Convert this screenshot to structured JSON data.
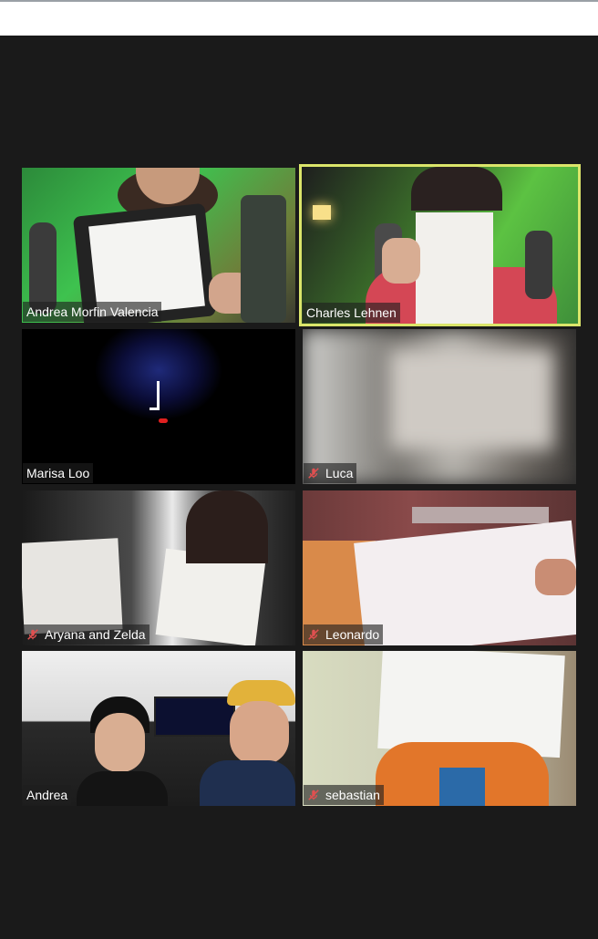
{
  "participants": [
    {
      "name": "Andrea Morfin Valencia",
      "muted": false,
      "active": false
    },
    {
      "name": "Charles Lehnen",
      "muted": false,
      "active": true
    },
    {
      "name": "Marisa Loo",
      "muted": false,
      "active": false
    },
    {
      "name": "Luca",
      "muted": true,
      "active": false
    },
    {
      "name": "Aryana and Zelda",
      "muted": true,
      "active": false
    },
    {
      "name": "Leonardo",
      "muted": true,
      "active": false
    },
    {
      "name": "Andrea",
      "muted": false,
      "active": false
    },
    {
      "name": "sebastian",
      "muted": true,
      "active": false
    }
  ],
  "colors": {
    "background": "#1a1a1a",
    "active_speaker_border": "#dbe56a",
    "mute_icon": "#e05050",
    "name_text": "#ffffff"
  },
  "icons": {
    "mute": "microphone-muted-icon"
  }
}
